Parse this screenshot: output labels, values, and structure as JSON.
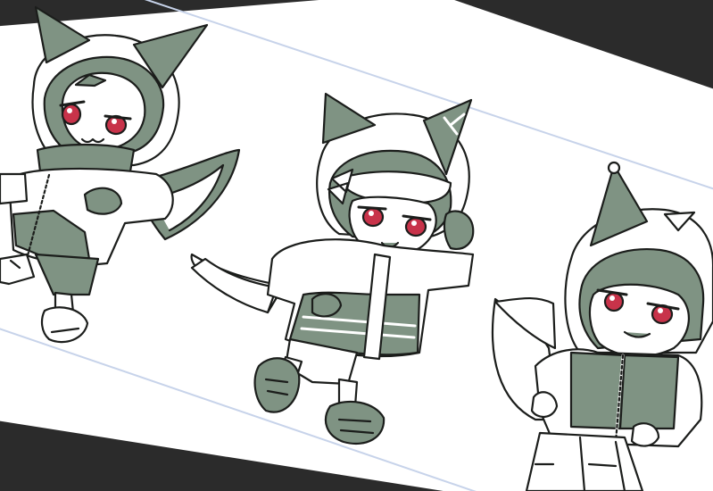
{
  "scene": {
    "background_color": "#2b2b2b",
    "paper_color": "#ffffff",
    "guide_line_color": "#c7d3ea",
    "ink_color": "#1b1d1b",
    "shade_color": "#7f9383",
    "shade_light_color": "#dfe6e0",
    "eye_color": "#c8334a",
    "characters": [
      {
        "name": "fox-character-left"
      },
      {
        "name": "fox-character-middle"
      },
      {
        "name": "fox-character-right"
      }
    ]
  }
}
